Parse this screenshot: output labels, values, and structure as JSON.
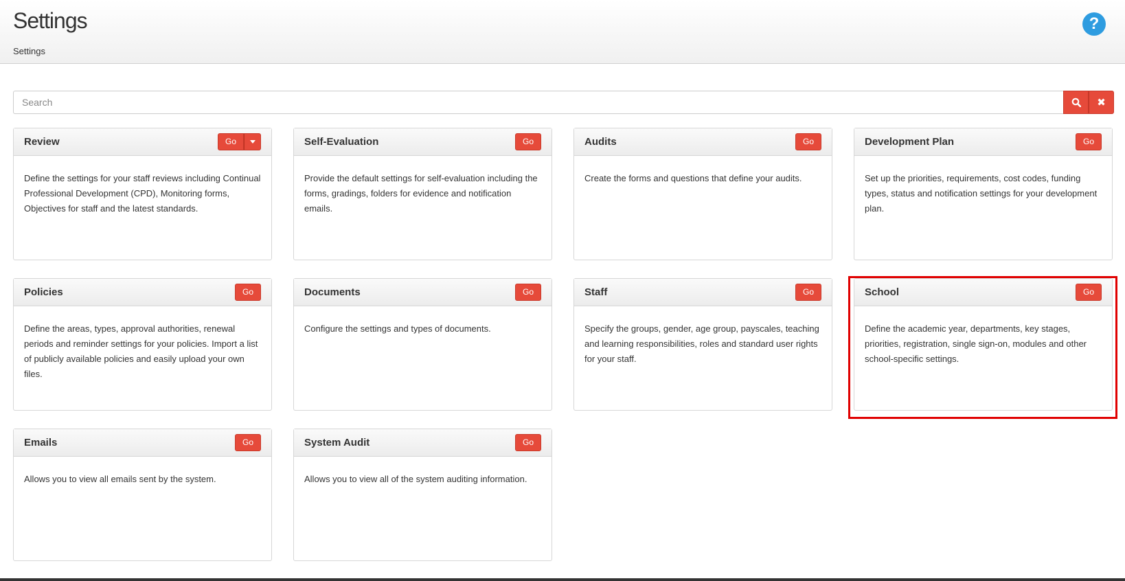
{
  "header": {
    "title": "Settings",
    "breadcrumb": "Settings",
    "help_icon": "question-icon",
    "help_label": "?"
  },
  "search": {
    "placeholder": "Search",
    "value": "",
    "search_icon": "search-icon",
    "clear_icon": "close-icon",
    "clear_label": "✖"
  },
  "cards": [
    {
      "title": "Review",
      "button": "Go",
      "has_dropdown": true,
      "description": "Define the settings for your staff reviews including Continual Professional Development (CPD), Monitoring forms, Objectives for staff and the latest standards."
    },
    {
      "title": "Self-Evaluation",
      "button": "Go",
      "description": "Provide the default settings for self-evaluation including the forms, gradings, folders for evidence and notification emails."
    },
    {
      "title": "Audits",
      "button": "Go",
      "description": "Create the forms and questions that define your audits."
    },
    {
      "title": "Development Plan",
      "button": "Go",
      "description": "Set up the priorities, requirements, cost codes, funding types, status and notification settings for your development plan."
    },
    {
      "title": "Policies",
      "button": "Go",
      "description": "Define the areas, types, approval authorities, renewal periods and reminder settings for your policies. Import a list of publicly available policies and easily upload your own files."
    },
    {
      "title": "Documents",
      "button": "Go",
      "description": "Configure the settings and types of documents."
    },
    {
      "title": "Staff",
      "button": "Go",
      "description": "Specify the groups, gender, age group, payscales, teaching and learning responsibilities, roles and standard user rights for your staff."
    },
    {
      "title": "School",
      "button": "Go",
      "highlighted": true,
      "description": "Define the academic year, departments, key stages, priorities, registration, single sign-on, modules and other school-specific settings."
    },
    {
      "title": "Emails",
      "button": "Go",
      "description": "Allows you to view all emails sent by the system."
    },
    {
      "title": "System Audit",
      "button": "Go",
      "description": "Allows you to view all of the system auditing information."
    }
  ],
  "colors": {
    "accent": "#e64a3a",
    "help": "#2e9ce0",
    "highlight": "#e00000"
  }
}
